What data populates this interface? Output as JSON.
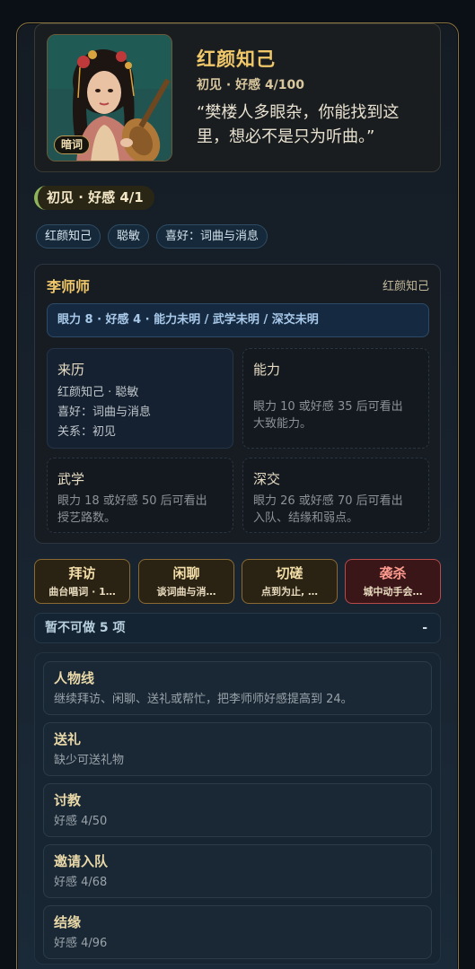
{
  "header": {
    "portrait_tag": "暗词",
    "title": "红颜知己",
    "meta": "初见 · 好感 4/100",
    "quote": "“樊楼人多眼杂，你能找到这里，想必不是只为听曲。”"
  },
  "status_pill": "初见 · 好感 4/1",
  "tags": [
    "红颜知己",
    "聪敏",
    "喜好：词曲与消息"
  ],
  "info": {
    "name": "李师师",
    "subtitle": "红颜知己",
    "stats": "眼力 8 · 好感 4 · 能力未明 / 武学未明 / 深交未明",
    "cards": {
      "origin": {
        "title": "来历",
        "lines": [
          "红颜知己 · 聪敏",
          "喜好：词曲与消息",
          "关系：初见"
        ]
      },
      "ability": {
        "title": "能力",
        "lines": [
          "眼力 10 或好感 35 后可看出",
          "大致能力。"
        ]
      },
      "martial": {
        "title": "武学",
        "lines": [
          "眼力 18 或好感 50 后可看出",
          "授艺路数。"
        ]
      },
      "bond": {
        "title": "深交",
        "lines": [
          "眼力 26 或好感 70 后可看出",
          "入队、结缘和弱点。"
        ]
      }
    }
  },
  "actions": [
    {
      "title": "拜访",
      "sub": "曲台唱词 · 1…"
    },
    {
      "title": "闲聊",
      "sub": "谈词曲与消…"
    },
    {
      "title": "切磋",
      "sub": "点到为止, …"
    },
    {
      "title": "袭杀",
      "sub": "城中动手会…"
    }
  ],
  "disabled": {
    "label": "暂不可做 5 项",
    "toggle": "-"
  },
  "disabled_items": [
    {
      "title": "人物线",
      "desc": "继续拜访、闲聊、送礼或帮忙，把李师师好感提高到 24。"
    },
    {
      "title": "送礼",
      "desc": "缺少可送礼物"
    },
    {
      "title": "讨教",
      "desc": "好感 4/50"
    },
    {
      "title": "邀请入队",
      "desc": "好感 4/68"
    },
    {
      "title": "结缘",
      "desc": "好感 4/96"
    }
  ]
}
